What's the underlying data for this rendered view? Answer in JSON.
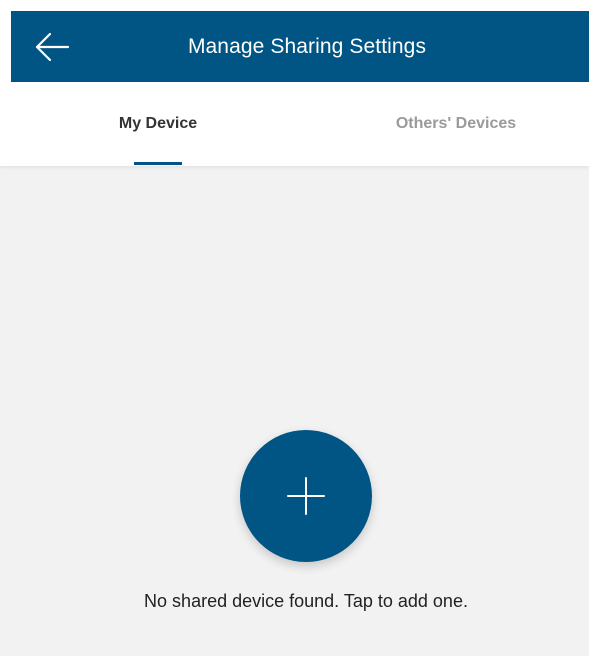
{
  "app_bar": {
    "title": "Manage Sharing Settings",
    "back_icon": "arrow-left-icon",
    "background_color": "#005584"
  },
  "tabs": [
    {
      "label": "My Device",
      "selected": true
    },
    {
      "label": "Others' Devices",
      "selected": false
    }
  ],
  "content": {
    "add_icon": "plus-icon",
    "empty_message": "No shared device found. Tap to add one.",
    "background_color": "#f2f2f2"
  },
  "colors": {
    "primary": "#005584",
    "tab_selected": "#333333",
    "tab_unselected": "#9a9a9a"
  }
}
